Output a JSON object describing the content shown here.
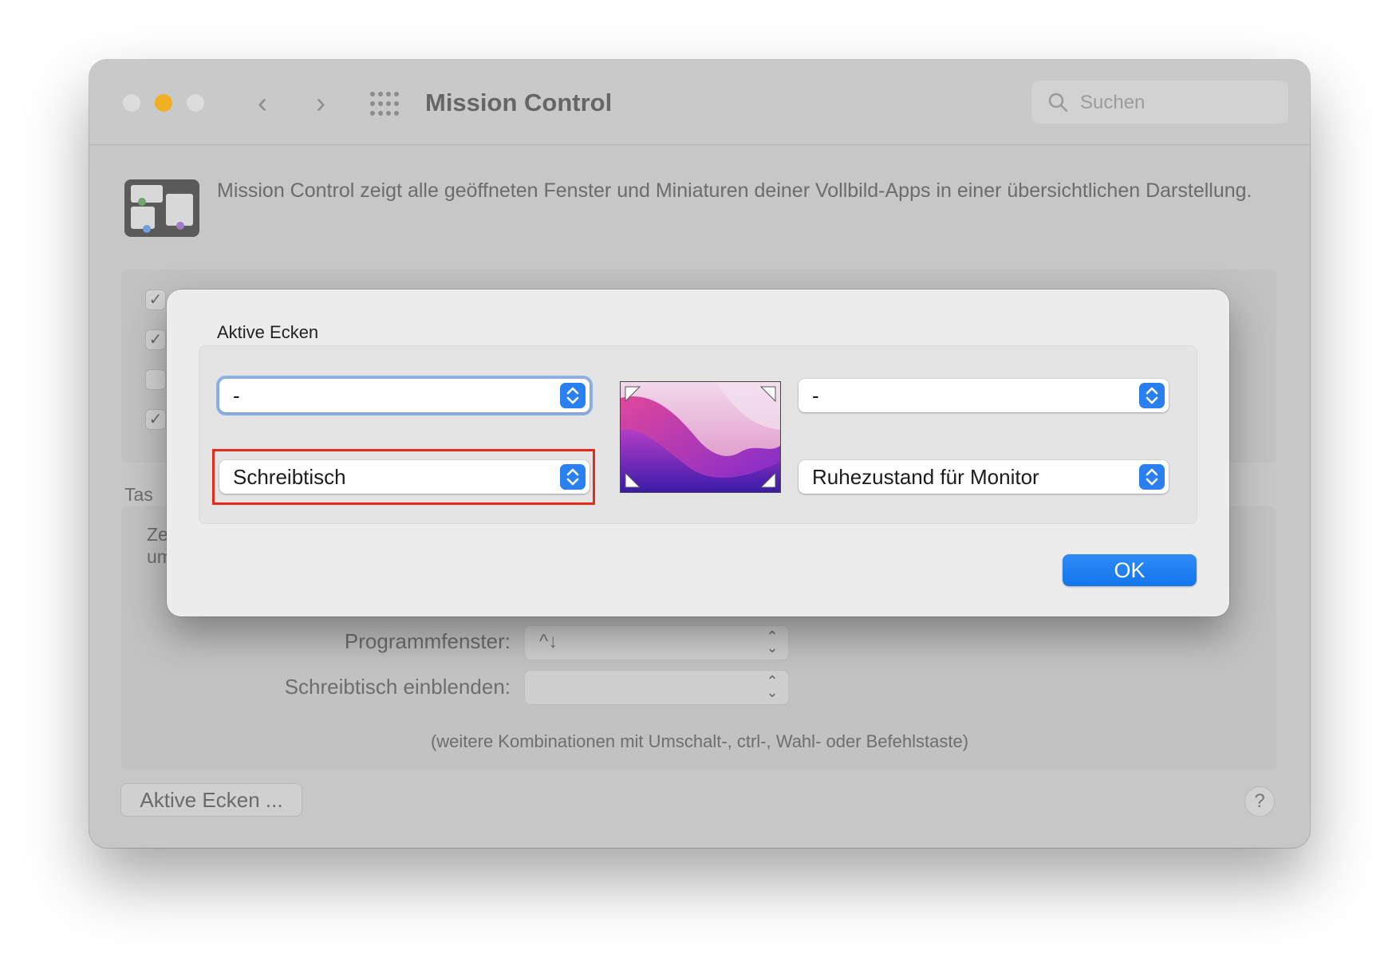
{
  "window": {
    "title": "Mission Control",
    "search_placeholder": "Suchen"
  },
  "description": "Mission Control zeigt alle geöffneten Fenster und Miniaturen deiner Vollbild-Apps in einer übersichtlichen Darstellung.",
  "checkboxes": [
    {
      "checked": true
    },
    {
      "checked": true
    },
    {
      "checked": false
    },
    {
      "checked": true
    }
  ],
  "partial_texts": {
    "section_label": "Tas",
    "line1": "Ze",
    "line2": "um"
  },
  "shortcuts": [
    {
      "label": "Programmfenster:",
      "value": "^↓"
    },
    {
      "label": "Schreibtisch einblenden:",
      "value": ""
    }
  ],
  "shortcuts_note": "(weitere Kombinationen mit Umschalt-, ctrl-, Wahl- oder Befehlstaste)",
  "hot_corners_button": "Aktive Ecken ...",
  "help_label": "?",
  "sheet": {
    "title": "Aktive Ecken",
    "top_left": "-",
    "top_right": "-",
    "bottom_left": "Schreibtisch",
    "bottom_right": "Ruhezustand für Monitor",
    "ok_label": "OK"
  },
  "colors": {
    "accent": "#1a73eb",
    "highlight_border": "#e8291c",
    "minimize_light": "#f0b022"
  }
}
